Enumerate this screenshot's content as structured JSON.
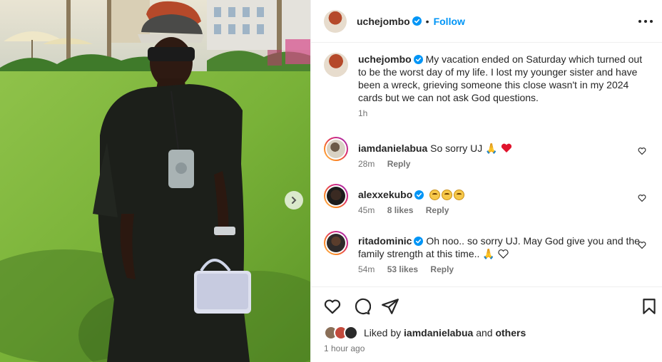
{
  "post": {
    "username": "uchejombo",
    "follow_label": "Follow",
    "caption": "My vacation ended on Saturday which turned out to be the worst day of my life. I lost my younger sister and have been a wreck, grieving someone this close wasn't in my 2024 cards but we can not ask God questions.",
    "caption_time": "1h"
  },
  "comments": [
    {
      "username": "iamdanielabua",
      "text": "So sorry UJ 🙏",
      "time": "28m",
      "likes": "",
      "reply": "Reply"
    },
    {
      "username": "alexxekubo",
      "text": "",
      "time": "45m",
      "likes": "8 likes",
      "reply": "Reply"
    },
    {
      "username": "ritadominic",
      "text": "Oh noo.. so sorry UJ. May God give you and the family strength at this time.. 🙏",
      "time": "54m",
      "likes": "53 likes",
      "reply": "Reply"
    }
  ],
  "likes_bar": {
    "prefix": "Liked by",
    "user": "iamdanielabua",
    "and": "and",
    "others": "others",
    "time_ago": "1 hour ago"
  },
  "icons": [
    "heart-icon",
    "comment-icon",
    "share-icon",
    "bookmark-icon",
    "more-icon",
    "verified-icon",
    "chevron-right-icon"
  ],
  "colors": {
    "accent": "#0095f6",
    "verified": "#0095f6",
    "text": "#262626",
    "muted": "#737373",
    "heart_red": "#e0142d"
  }
}
